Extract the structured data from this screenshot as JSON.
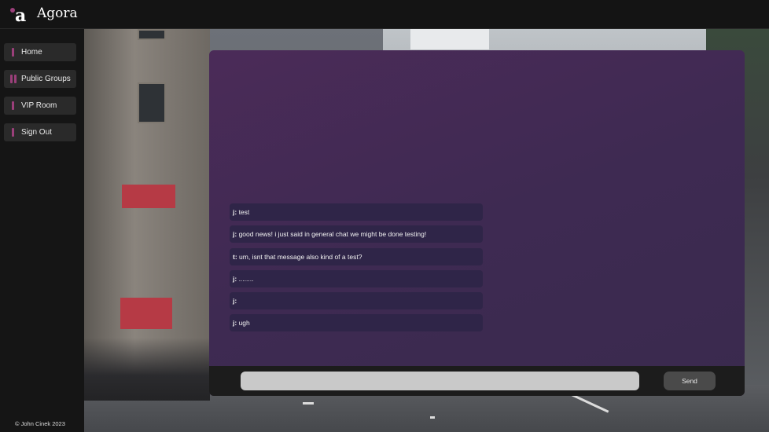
{
  "app": {
    "logo_letter": "a",
    "title": "Agora"
  },
  "sidebar": {
    "items": [
      {
        "label": "Home",
        "icon": "single-bar-icon"
      },
      {
        "label": "Public Groups",
        "icon": "double-bar-icon"
      },
      {
        "label": "VIP Room",
        "icon": "single-bar-icon"
      },
      {
        "label": "Sign Out",
        "icon": "single-bar-icon"
      }
    ],
    "copyright": "© John Cinek 2023"
  },
  "chat": {
    "messages": [
      {
        "author": "j:",
        "text": " test"
      },
      {
        "author": "j:",
        "text": " good news! i just said in general chat we might be done testing!"
      },
      {
        "author": "t:",
        "text": " um, isnt that message also kind of a test?"
      },
      {
        "author": "j:",
        "text": " ........"
      },
      {
        "author": "j:",
        "text": ""
      },
      {
        "author": "j:",
        "text": " ugh"
      }
    ],
    "input": {
      "value": "",
      "placeholder": ""
    },
    "send_label": "Send"
  },
  "colors": {
    "accent": "#9b3f7a",
    "panel": "#452b57",
    "message_bg": "#2f2548",
    "input_bar": "#1c1c1c"
  }
}
